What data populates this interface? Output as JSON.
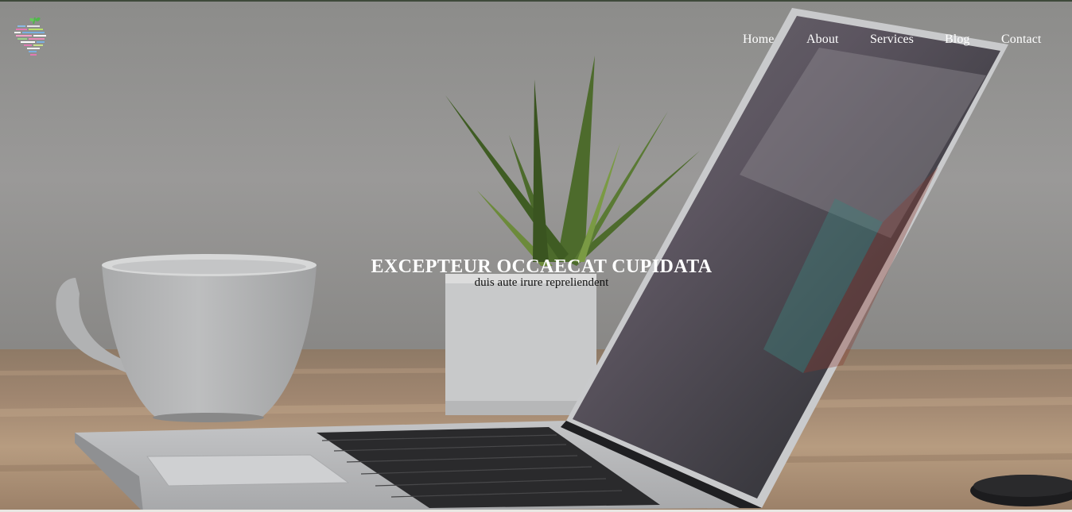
{
  "nav": {
    "items": [
      {
        "label": "Home"
      },
      {
        "label": "About"
      },
      {
        "label": "Services"
      },
      {
        "label": "Blog"
      },
      {
        "label": "Contact"
      }
    ]
  },
  "hero": {
    "title": "EXCEPTEUR OCCAECAT CUPIDATA",
    "subtitle": "duis aute irure repreliendent"
  },
  "colors": {
    "nav_text": "#ffffff",
    "title_text": "#ffffff",
    "subtitle_text": "#111111"
  },
  "icons": {
    "logo": "striped-leaf-logo-icon"
  }
}
